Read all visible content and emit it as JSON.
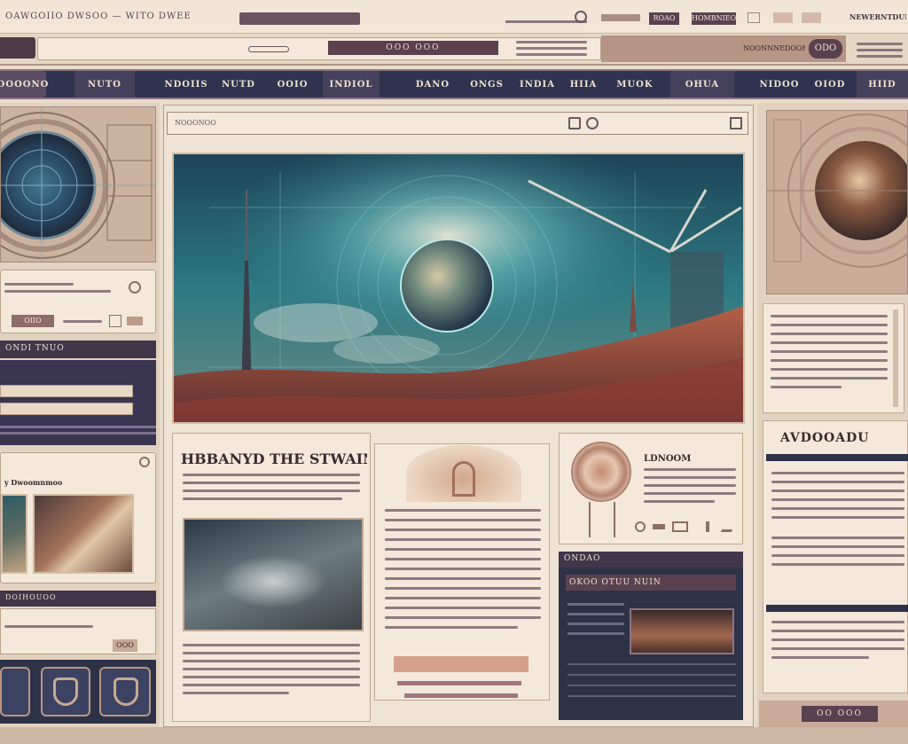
{
  "browser": {
    "title": "OAWGOIIO DWSOO — WITO DWEE",
    "right_label_1": "ROAO",
    "right_label_2": "HOMBNIEON",
    "right_label_3": "NEWERNTDUNE"
  },
  "toolbar": {
    "center_button": "OOO  OOO",
    "right_label": "NOONNNEDOOR",
    "right_button": "ODO"
  },
  "nav": {
    "left_button": "OOOONO",
    "items": [
      "NUTO",
      "NDOIIS",
      "NUTD",
      "OOIO",
      "INDIOL",
      "DANO",
      "ONGS",
      "INDIA",
      "HIIA",
      "MUOK",
      "OHUA",
      "NIDOO",
      "OIOD",
      "HIID"
    ]
  },
  "left_sidebar": {
    "panel1_button": "OIIO",
    "section_header": "ONDI TNUO",
    "card_title": "y Dwoomnmoo",
    "footer_label": "DOIHOUOO",
    "bottom_button": "OOO"
  },
  "main": {
    "address_placeholder": "NOOONOO",
    "heading": "HBBANYD THE STWAINI!",
    "right_card_title": "LDNOOM",
    "dark_panel_label": "ONDAO",
    "dark_panel_title": "OKOO OTUU NUIN"
  },
  "right_sidebar": {
    "card_title": "AVDOOADU",
    "bottom_button": "OO OOO"
  },
  "colors": {
    "accent": "#5a4150",
    "nav_bg": "#2f3350",
    "paper": "#f3e8d9",
    "sky": "#2a6a78",
    "hills": "#b35a3a"
  }
}
